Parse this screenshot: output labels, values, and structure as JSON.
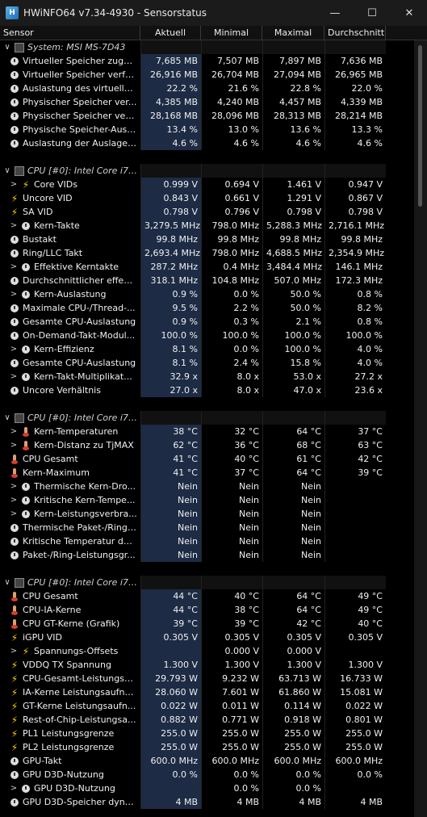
{
  "window": {
    "title": "HWiNFO64 v7.34-4930 - Sensorstatus"
  },
  "columns": [
    "Sensor",
    "Aktuell",
    "Minimal",
    "Maximal",
    "Durchschnitt"
  ],
  "rows": [
    {
      "t": "group",
      "label": "System: MSI MS-7D43",
      "exp": "∨"
    },
    {
      "t": "s",
      "icon": "clock",
      "indent": 0,
      "label": "Virtueller Speicher zuge...",
      "v": [
        "7,685 MB",
        "7,507 MB",
        "7,897 MB",
        "7,636 MB"
      ]
    },
    {
      "t": "s",
      "icon": "clock",
      "indent": 0,
      "label": "Virtueller Speicher verfü...",
      "v": [
        "26,916 MB",
        "26,704 MB",
        "27,094 MB",
        "26,965 MB"
      ]
    },
    {
      "t": "s",
      "icon": "clock",
      "indent": 0,
      "label": "Auslastung des virtuelle...",
      "v": [
        "22.2 %",
        "21.6 %",
        "22.8 %",
        "22.0 %"
      ]
    },
    {
      "t": "s",
      "icon": "clock",
      "indent": 0,
      "label": "Physischer Speicher ver...",
      "v": [
        "4,385 MB",
        "4,240 MB",
        "4,457 MB",
        "4,339 MB"
      ]
    },
    {
      "t": "s",
      "icon": "clock",
      "indent": 0,
      "label": "Physischer Speicher verf...",
      "v": [
        "28,168 MB",
        "28,096 MB",
        "28,313 MB",
        "28,214 MB"
      ]
    },
    {
      "t": "s",
      "icon": "clock",
      "indent": 0,
      "label": "Physische Speicher-Ausl...",
      "v": [
        "13.4 %",
        "13.0 %",
        "13.6 %",
        "13.3 %"
      ]
    },
    {
      "t": "s",
      "icon": "clock",
      "indent": 0,
      "label": "Auslastung der Auslager...",
      "v": [
        "4.6 %",
        "4.6 %",
        "4.6 %",
        "4.6 %"
      ]
    },
    {
      "t": "sep"
    },
    {
      "t": "group",
      "label": "CPU [#0]: Intel Core i7-...",
      "exp": "∨"
    },
    {
      "t": "s",
      "icon": "bolt",
      "indent": 1,
      "exp": ">",
      "label": "Core VIDs",
      "v": [
        "0.999 V",
        "0.694 V",
        "1.461 V",
        "0.947 V"
      ]
    },
    {
      "t": "s",
      "icon": "bolt",
      "indent": 0,
      "label": "Uncore VID",
      "v": [
        "0.843 V",
        "0.661 V",
        "1.291 V",
        "0.867 V"
      ]
    },
    {
      "t": "s",
      "icon": "bolt",
      "indent": 0,
      "label": "SA VID",
      "v": [
        "0.798 V",
        "0.796 V",
        "0.798 V",
        "0.798 V"
      ]
    },
    {
      "t": "s",
      "icon": "clock",
      "indent": 1,
      "exp": ">",
      "label": "Kern-Takte",
      "v": [
        "3,279.5 MHz",
        "798.0 MHz",
        "5,288.3 MHz",
        "2,716.1 MHz"
      ]
    },
    {
      "t": "s",
      "icon": "clock",
      "indent": 0,
      "label": "Bustakt",
      "v": [
        "99.8 MHz",
        "99.8 MHz",
        "99.8 MHz",
        "99.8 MHz"
      ]
    },
    {
      "t": "s",
      "icon": "clock",
      "indent": 0,
      "label": "Ring/LLC Takt",
      "v": [
        "2,693.4 MHz",
        "798.0 MHz",
        "4,688.5 MHz",
        "2,354.9 MHz"
      ]
    },
    {
      "t": "s",
      "icon": "clock",
      "indent": 1,
      "exp": ">",
      "label": "Effektive Kerntakte",
      "v": [
        "287.2 MHz",
        "0.4 MHz",
        "3,484.4 MHz",
        "146.1 MHz"
      ]
    },
    {
      "t": "s",
      "icon": "clock",
      "indent": 0,
      "label": "Durchschnittlicher effekti...",
      "v": [
        "318.1 MHz",
        "104.8 MHz",
        "507.0 MHz",
        "172.3 MHz"
      ]
    },
    {
      "t": "s",
      "icon": "clock",
      "indent": 1,
      "exp": ">",
      "label": "Kern-Auslastung",
      "v": [
        "0.9 %",
        "0.0 %",
        "50.0 %",
        "0.8 %"
      ]
    },
    {
      "t": "s",
      "icon": "clock",
      "indent": 0,
      "label": "Maximale CPU-/Thread-...",
      "v": [
        "9.5 %",
        "2.2 %",
        "50.0 %",
        "8.2 %"
      ]
    },
    {
      "t": "s",
      "icon": "clock",
      "indent": 0,
      "label": "Gesamte CPU-Auslastung",
      "v": [
        "0.9 %",
        "0.3 %",
        "2.1 %",
        "0.8 %"
      ]
    },
    {
      "t": "s",
      "icon": "clock",
      "indent": 0,
      "label": "On-Demand-Takt-Modul...",
      "v": [
        "100.0 %",
        "100.0 %",
        "100.0 %",
        "100.0 %"
      ]
    },
    {
      "t": "s",
      "icon": "clock",
      "indent": 1,
      "exp": ">",
      "label": "Kern-Effizienz",
      "v": [
        "8.1 %",
        "0.0 %",
        "100.0 %",
        "4.0 %"
      ]
    },
    {
      "t": "s",
      "icon": "clock",
      "indent": 0,
      "label": "Gesamte CPU-Auslastung",
      "v": [
        "8.1 %",
        "2.4 %",
        "15.8 %",
        "4.0 %"
      ]
    },
    {
      "t": "s",
      "icon": "clock",
      "indent": 1,
      "exp": ">",
      "label": "Kern-Takt-Multiplikat...",
      "v": [
        "32.9 x",
        "8.0 x",
        "53.0 x",
        "27.2 x"
      ]
    },
    {
      "t": "s",
      "icon": "clock",
      "indent": 0,
      "label": "Uncore Verhältnis",
      "v": [
        "27.0 x",
        "8.0 x",
        "47.0 x",
        "23.6 x"
      ]
    },
    {
      "t": "sep"
    },
    {
      "t": "group",
      "label": "CPU [#0]: Intel Core i7-...",
      "exp": "∨"
    },
    {
      "t": "s",
      "icon": "therm",
      "indent": 1,
      "exp": ">",
      "label": "Kern-Temperaturen",
      "v": [
        "38 °C",
        "32 °C",
        "64 °C",
        "37 °C"
      ]
    },
    {
      "t": "s",
      "icon": "therm",
      "indent": 1,
      "exp": ">",
      "label": "Kern-Distanz zu TjMAX",
      "v": [
        "62 °C",
        "36 °C",
        "68 °C",
        "63 °C"
      ]
    },
    {
      "t": "s",
      "icon": "therm",
      "indent": 0,
      "label": "CPU Gesamt",
      "v": [
        "41 °C",
        "40 °C",
        "61 °C",
        "42 °C"
      ]
    },
    {
      "t": "s",
      "icon": "therm",
      "indent": 0,
      "label": "Kern-Maximum",
      "v": [
        "41 °C",
        "37 °C",
        "64 °C",
        "39 °C"
      ]
    },
    {
      "t": "s",
      "icon": "clock",
      "indent": 1,
      "exp": ">",
      "label": "Thermische Kern-Dro...",
      "v": [
        "Nein",
        "Nein",
        "Nein",
        ""
      ]
    },
    {
      "t": "s",
      "icon": "clock",
      "indent": 1,
      "exp": ">",
      "label": "Kritische Kern-Tempe...",
      "v": [
        "Nein",
        "Nein",
        "Nein",
        ""
      ]
    },
    {
      "t": "s",
      "icon": "clock",
      "indent": 1,
      "exp": ">",
      "label": "Kern-Leistungsverbra...",
      "v": [
        "Nein",
        "Nein",
        "Nein",
        ""
      ]
    },
    {
      "t": "s",
      "icon": "clock",
      "indent": 0,
      "label": "Thermische Paket-/Ring-...",
      "v": [
        "Nein",
        "Nein",
        "Nein",
        ""
      ]
    },
    {
      "t": "s",
      "icon": "clock",
      "indent": 0,
      "label": "Kritische Temperatur des...",
      "v": [
        "Nein",
        "Nein",
        "Nein",
        ""
      ]
    },
    {
      "t": "s",
      "icon": "clock",
      "indent": 0,
      "label": "Paket-/Ring-Leistungsgr...",
      "v": [
        "Nein",
        "Nein",
        "Nein",
        ""
      ]
    },
    {
      "t": "sep"
    },
    {
      "t": "group",
      "label": "CPU [#0]: Intel Core i7-...",
      "exp": "∨"
    },
    {
      "t": "s",
      "icon": "therm",
      "indent": 0,
      "label": "CPU Gesamt",
      "v": [
        "44 °C",
        "40 °C",
        "64 °C",
        "49 °C"
      ]
    },
    {
      "t": "s",
      "icon": "therm",
      "indent": 0,
      "label": "CPU-IA-Kerne",
      "v": [
        "44 °C",
        "38 °C",
        "64 °C",
        "49 °C"
      ]
    },
    {
      "t": "s",
      "icon": "therm",
      "indent": 0,
      "label": "CPU GT-Kerne (Grafik)",
      "v": [
        "39 °C",
        "39 °C",
        "42 °C",
        "40 °C"
      ]
    },
    {
      "t": "s",
      "icon": "bolt",
      "indent": 0,
      "label": "iGPU VID",
      "v": [
        "0.305 V",
        "0.305 V",
        "0.305 V",
        "0.305 V"
      ]
    },
    {
      "t": "s",
      "icon": "bolt",
      "indent": 1,
      "exp": ">",
      "label": "Spannungs-Offsets",
      "v": [
        "",
        "0.000 V",
        "0.000 V",
        ""
      ]
    },
    {
      "t": "s",
      "icon": "bolt",
      "indent": 0,
      "label": "VDDQ TX Spannung",
      "v": [
        "1.300 V",
        "1.300 V",
        "1.300 V",
        "1.300 V"
      ]
    },
    {
      "t": "s",
      "icon": "bolt",
      "indent": 0,
      "label": "CPU-Gesamt-Leistungsa...",
      "v": [
        "29.793 W",
        "9.232 W",
        "63.713 W",
        "16.733 W"
      ]
    },
    {
      "t": "s",
      "icon": "bolt",
      "indent": 0,
      "label": "IA-Kerne Leistungsaufna...",
      "v": [
        "28.060 W",
        "7.601 W",
        "61.860 W",
        "15.081 W"
      ]
    },
    {
      "t": "s",
      "icon": "bolt",
      "indent": 0,
      "label": "GT-Kerne Leistungsaufn...",
      "v": [
        "0.022 W",
        "0.011 W",
        "0.114 W",
        "0.022 W"
      ]
    },
    {
      "t": "s",
      "icon": "bolt",
      "indent": 0,
      "label": "Rest-of-Chip-Leistungsa...",
      "v": [
        "0.882 W",
        "0.771 W",
        "0.918 W",
        "0.801 W"
      ]
    },
    {
      "t": "s",
      "icon": "bolt",
      "indent": 0,
      "label": "PL1 Leistungsgrenze",
      "v": [
        "255.0 W",
        "255.0 W",
        "255.0 W",
        "255.0 W"
      ]
    },
    {
      "t": "s",
      "icon": "bolt",
      "indent": 0,
      "label": "PL2 Leistungsgrenze",
      "v": [
        "255.0 W",
        "255.0 W",
        "255.0 W",
        "255.0 W"
      ]
    },
    {
      "t": "s",
      "icon": "clock",
      "indent": 0,
      "label": "GPU-Takt",
      "v": [
        "600.0 MHz",
        "600.0 MHz",
        "600.0 MHz",
        "600.0 MHz"
      ]
    },
    {
      "t": "s",
      "icon": "clock",
      "indent": 0,
      "label": "GPU D3D-Nutzung",
      "v": [
        "0.0 %",
        "0.0 %",
        "0.0 %",
        "0.0 %"
      ]
    },
    {
      "t": "s",
      "icon": "clock",
      "indent": 1,
      "exp": ">",
      "label": "GPU D3D-Nutzung",
      "v": [
        "",
        "0.0 %",
        "0.0 %",
        ""
      ]
    },
    {
      "t": "s",
      "icon": "clock",
      "indent": 0,
      "label": "GPU D3D-Speicher dyna...",
      "v": [
        "4 MB",
        "4 MB",
        "4 MB",
        "4 MB"
      ]
    }
  ]
}
